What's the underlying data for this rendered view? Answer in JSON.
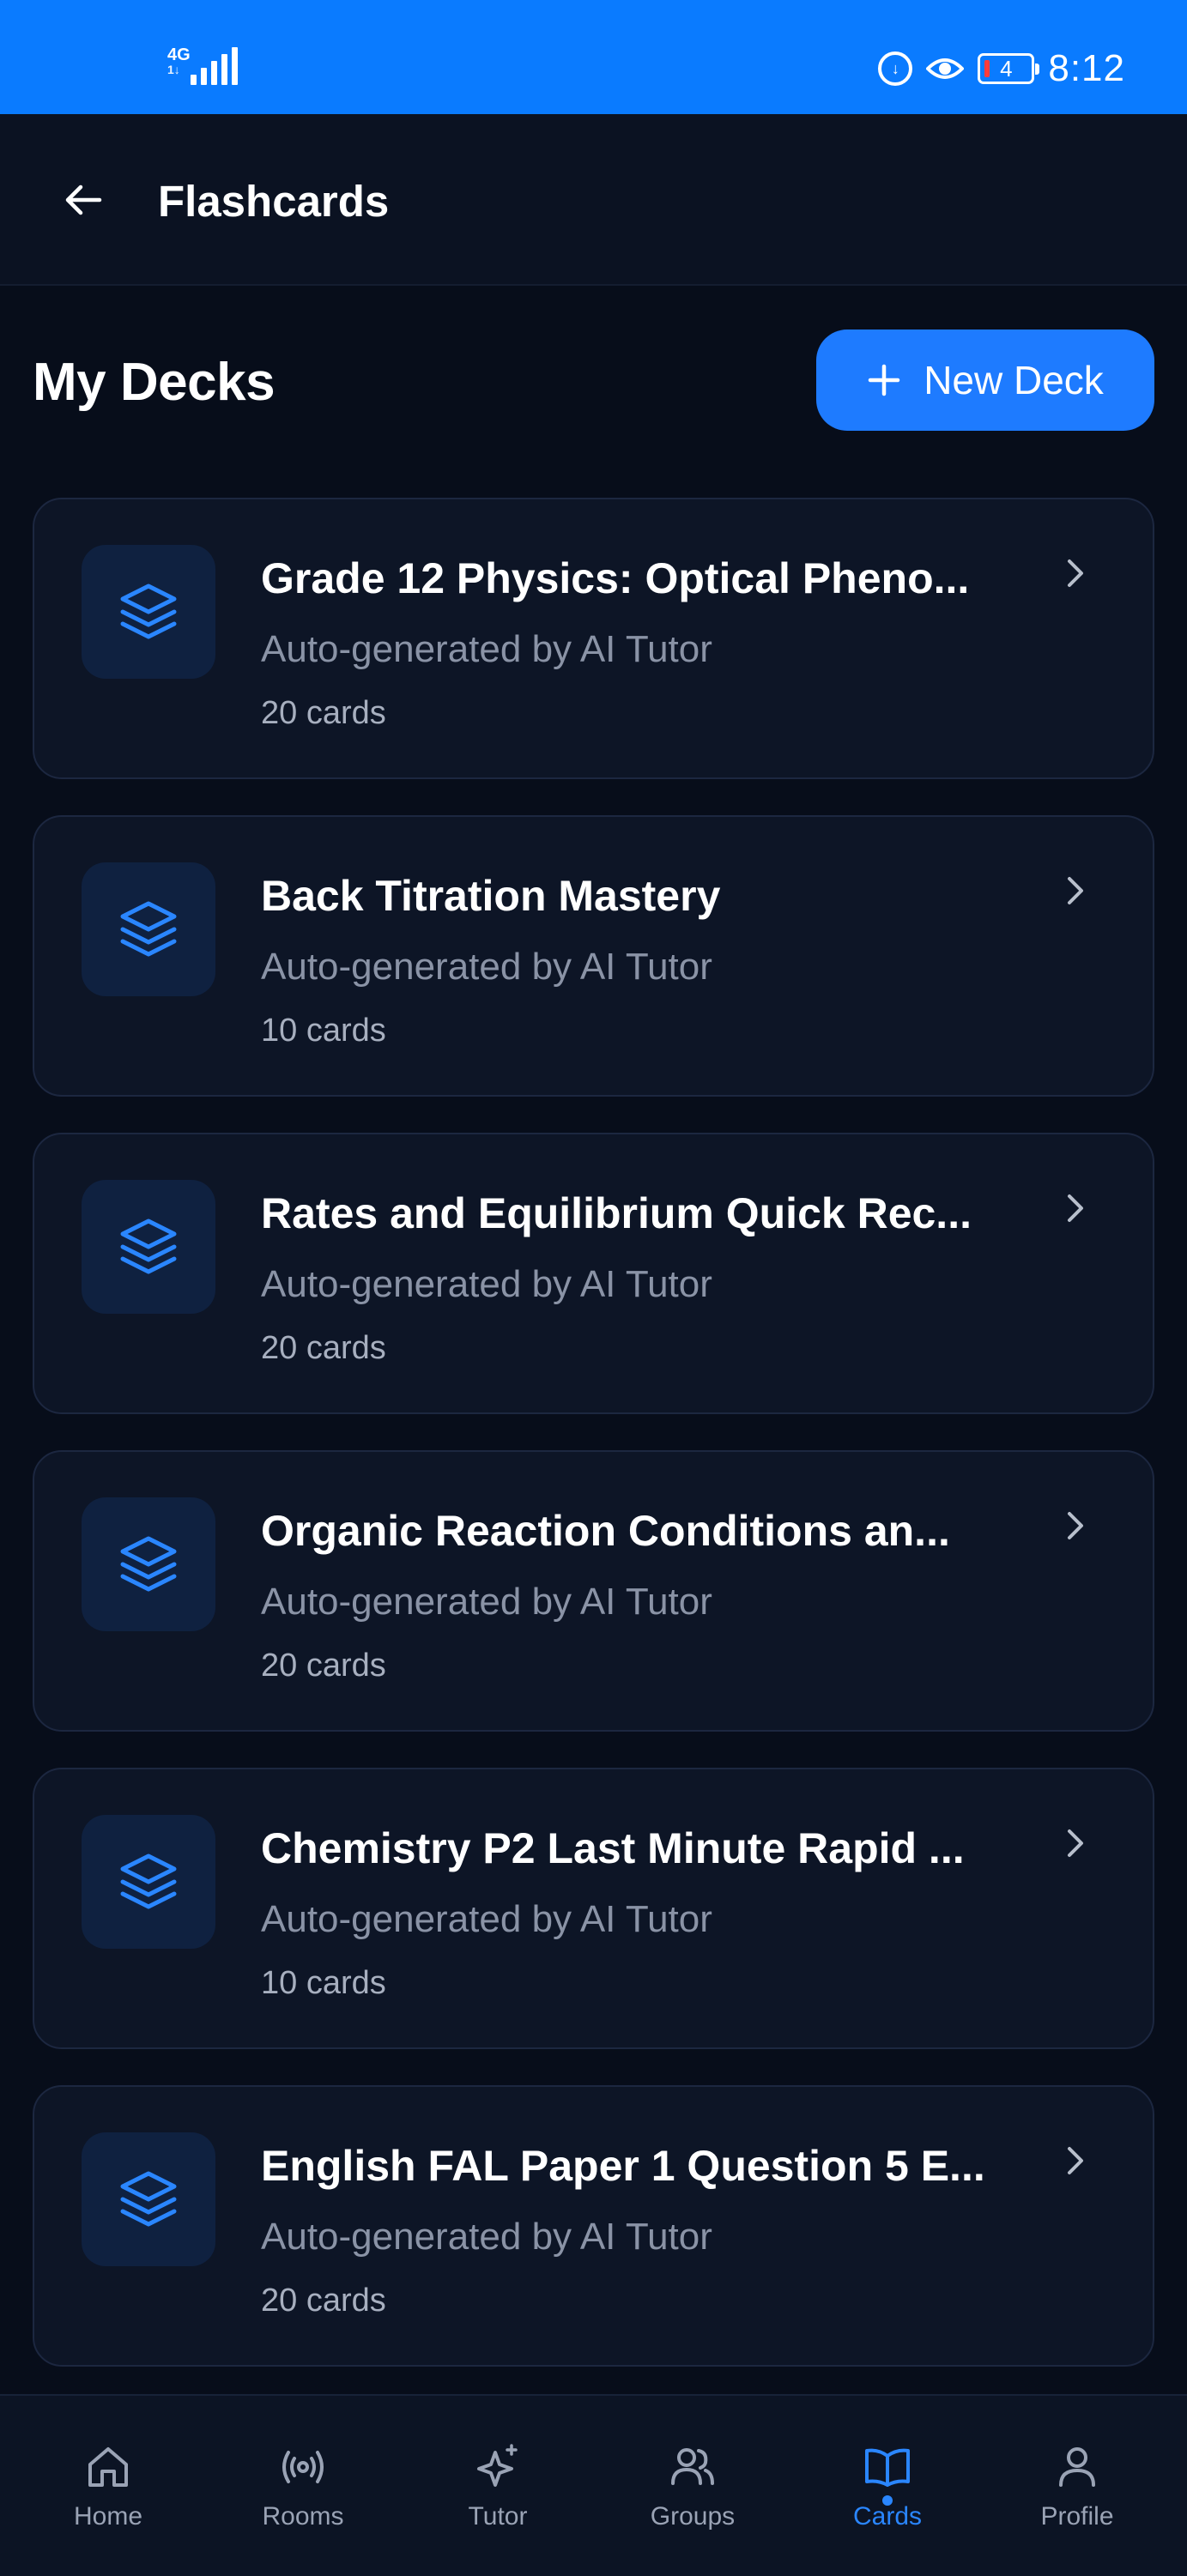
{
  "status_bar": {
    "network": "4G",
    "network_sub": "1↓",
    "time": "8:12",
    "battery": "4",
    "icons": [
      "data-saver-icon",
      "eye-comfort-icon"
    ]
  },
  "header": {
    "back_icon": "arrow-left-icon",
    "title": "Flashcards"
  },
  "section": {
    "title": "My Decks",
    "new_deck_label": "New Deck"
  },
  "decks": [
    {
      "title": "Grade 12 Physics: Optical Pheno...",
      "subtitle": "Auto-generated by AI Tutor",
      "count": "20 cards"
    },
    {
      "title": "Back Titration Mastery",
      "subtitle": "Auto-generated by AI Tutor",
      "count": "10 cards"
    },
    {
      "title": "Rates and Equilibrium Quick Rec...",
      "subtitle": "Auto-generated by AI Tutor",
      "count": "20 cards"
    },
    {
      "title": "Organic Reaction Conditions an...",
      "subtitle": "Auto-generated by AI Tutor",
      "count": "20 cards"
    },
    {
      "title": "Chemistry P2 Last Minute Rapid ...",
      "subtitle": "Auto-generated by AI Tutor",
      "count": "10 cards"
    },
    {
      "title": "English FAL Paper 1 Question 5 E...",
      "subtitle": "Auto-generated by AI Tutor",
      "count": "20 cards"
    }
  ],
  "bottom_nav": {
    "active": "Cards",
    "items": [
      {
        "label": "Home",
        "icon": "home-icon"
      },
      {
        "label": "Rooms",
        "icon": "broadcast-icon"
      },
      {
        "label": "Tutor",
        "icon": "sparkles-icon"
      },
      {
        "label": "Groups",
        "icon": "users-icon"
      },
      {
        "label": "Cards",
        "icon": "book-open-icon"
      },
      {
        "label": "Profile",
        "icon": "user-icon"
      }
    ]
  },
  "colors": {
    "status_bar": "#0a7bff",
    "background": "#070d1a",
    "card": "#0d1526",
    "accent": "#1e7bff",
    "muted_text": "#8a93a6"
  }
}
